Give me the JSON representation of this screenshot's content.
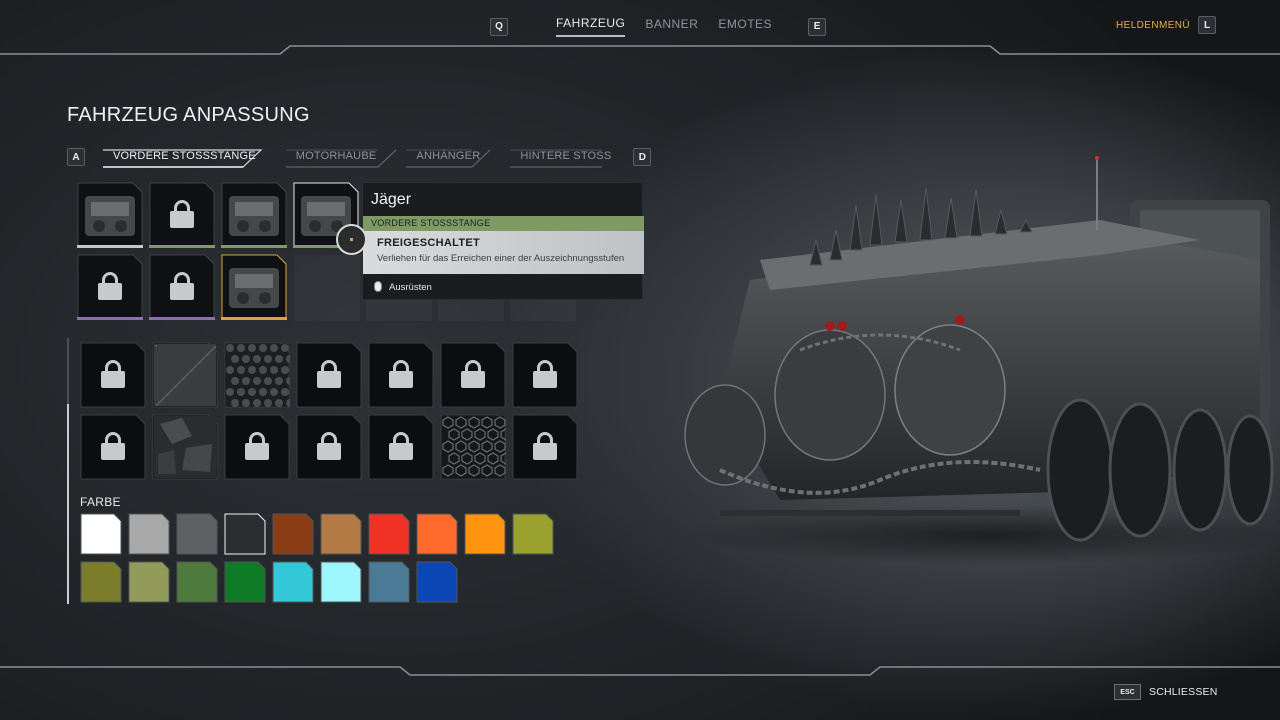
{
  "topnav": {
    "left_key": "Q",
    "right_key": "E",
    "tabs": [
      {
        "label": "FAHRZEUG",
        "active": true
      },
      {
        "label": "BANNER",
        "active": false
      },
      {
        "label": "EMOTES",
        "active": false
      }
    ],
    "hero_menu_label": "HELDENMENÜ",
    "hero_menu_key": "L"
  },
  "page": {
    "title": "FAHRZEUG ANPASSUNG"
  },
  "subtabs": {
    "left_key": "A",
    "right_key": "D",
    "items": [
      {
        "label": "VORDERE STOSSSTANGE",
        "active": true
      },
      {
        "label": "MOTORHAUBE",
        "active": false
      },
      {
        "label": "ANHÄNGER",
        "active": false
      },
      {
        "label": "HINTERE STOSS",
        "active": false
      }
    ]
  },
  "parts": [
    {
      "state": "thumbnail",
      "rarity_color": "#c4c7c9"
    },
    {
      "state": "locked",
      "rarity_color": "#7f9a64"
    },
    {
      "state": "thumbnail",
      "rarity_color": "#7f9a64"
    },
    {
      "state": "thumbnail",
      "rarity_color": "#7f9a64",
      "selected": true
    },
    {
      "state": "locked",
      "rarity_color": "#8a6fb3"
    },
    {
      "state": "locked",
      "rarity_color": "#8a6fb3"
    },
    {
      "state": "thumbnail",
      "rarity_color": "#d9a441",
      "equipped": true
    }
  ],
  "tooltip": {
    "name": "Jäger",
    "category": "VORDERE STOSSSTANGE",
    "status": "FREIGESCHALTET",
    "description": "Verliehen für das Erreichen einer der Auszeichnungsstufen",
    "action": "Ausrüsten"
  },
  "patterns": [
    "locked",
    "pattern-noise",
    "pattern-hexdots",
    "locked",
    "locked",
    "locked",
    "locked",
    "locked",
    "pattern-camo",
    "locked",
    "locked",
    "locked",
    "pattern-hexgrid",
    "locked"
  ],
  "color_section": {
    "label": "FARBE",
    "swatches": [
      "#ffffff",
      "#a8a8a8",
      "#5d6163",
      "#2a2e31",
      "#8a3d14",
      "#b37a45",
      "#ef3224",
      "#ff6a2d",
      "#ff9410",
      "#9aa12e",
      "#7b7d2a",
      "#939b5a",
      "#4e7a3e",
      "#0f7b26",
      "#33c8d7",
      "#9cf6fb",
      "#4a7a95",
      "#0a47b4"
    ],
    "selected_index": 3
  },
  "footer": {
    "esc_key": "ESC",
    "close_label": "SCHLIESSEN"
  }
}
